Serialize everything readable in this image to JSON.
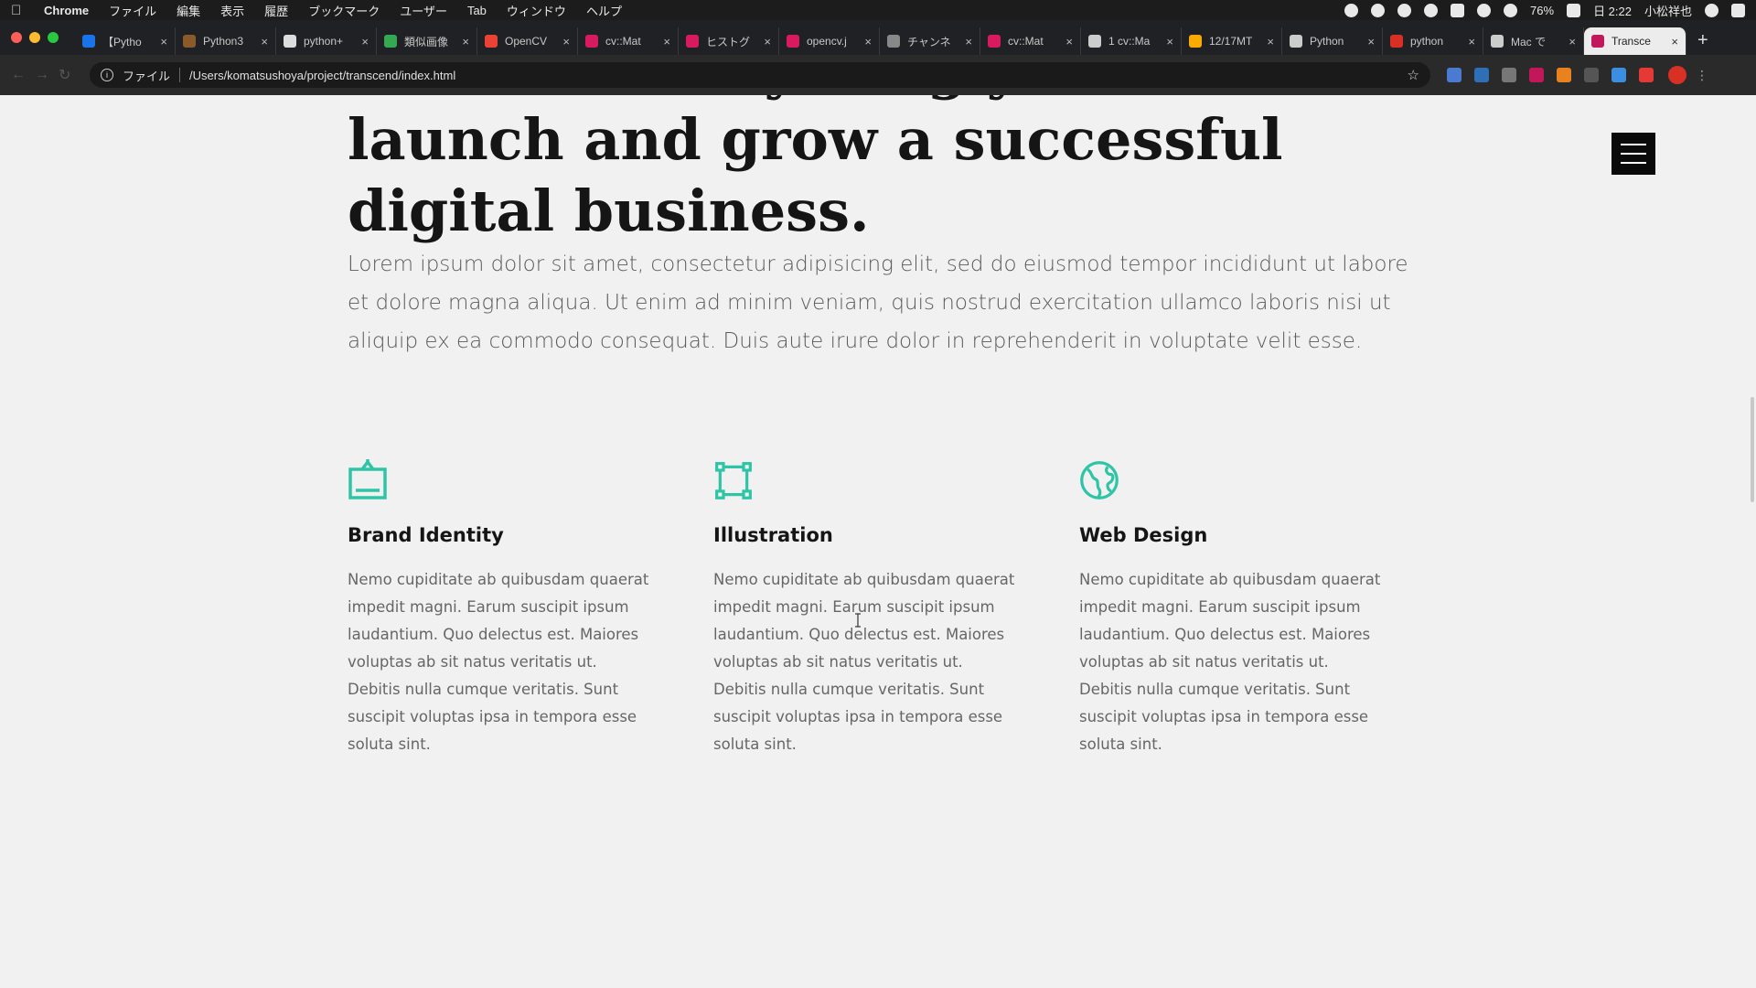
{
  "menubar": {
    "app": "Chrome",
    "items": [
      "ファイル",
      "編集",
      "表示",
      "履歴",
      "ブックマーク",
      "ユーザー",
      "Tab",
      "ウィンドウ",
      "ヘルプ"
    ],
    "battery": "76%",
    "clock": "日 2:22",
    "user": "小松祥也"
  },
  "tabs": [
    {
      "label": "【Pytho",
      "color": "#1a73e8"
    },
    {
      "label": "Python3",
      "color": "#8b5a2b"
    },
    {
      "label": "python+",
      "color": "#dddddd"
    },
    {
      "label": "類似画像",
      "color": "#34a853"
    },
    {
      "label": "OpenCV",
      "color": "#ea4335"
    },
    {
      "label": "cv::Mat",
      "color": "#d81b60"
    },
    {
      "label": "ヒストグ",
      "color": "#d81b60"
    },
    {
      "label": "opencv.j",
      "color": "#d81b60"
    },
    {
      "label": "チャンネ",
      "color": "#888888"
    },
    {
      "label": "cv::Mat",
      "color": "#d81b60"
    },
    {
      "label": "1 cv::Ma",
      "color": "#cccccc"
    },
    {
      "label": "12/17MT",
      "color": "#f9ab00"
    },
    {
      "label": "Python",
      "color": "#cccccc"
    },
    {
      "label": "python",
      "color": "#d93025"
    },
    {
      "label": "Mac で",
      "color": "#cccccc"
    },
    {
      "label": "Transce",
      "color": "#c2185b",
      "active": true
    }
  ],
  "toolbar": {
    "scheme": "ファイル",
    "url": "/Users/komatsushoya/project/transcend/index.html"
  },
  "page": {
    "headline": "We have everything you need to launch and grow a successful digital business.",
    "lead": "Lorem ipsum dolor sit amet, consectetur adipisicing elit, sed do eiusmod tempor incididunt ut labore et dolore magna aliqua. Ut enim ad minim veniam, quis nostrud exercitation ullamco laboris nisi ut aliquip ex ea commodo consequat. Duis aute irure dolor in reprehenderit in voluptate velit esse.",
    "accent_color": "#2ec4a6",
    "features": [
      {
        "icon": "tv-icon",
        "title": "Brand Identity",
        "text": "Nemo cupiditate ab quibusdam quaerat impedit magni. Earum suscipit ipsum laudantium. Quo delectus est. Maiores voluptas ab sit natus veritatis ut. Debitis nulla cumque veritatis. Sunt suscipit voluptas ipsa in tempora esse soluta sint."
      },
      {
        "icon": "vector-square-icon",
        "title": "Illustration",
        "text": "Nemo cupiditate ab quibusdam quaerat impedit magni. Earum suscipit ipsum laudantium. Quo delectus est. Maiores voluptas ab sit natus veritatis ut. Debitis nulla cumque veritatis. Sunt suscipit voluptas ipsa in tempora esse soluta sint."
      },
      {
        "icon": "globe-icon",
        "title": "Web Design",
        "text": "Nemo cupiditate ab quibusdam quaerat impedit magni. Earum suscipit ipsum laudantium. Quo delectus est. Maiores voluptas ab sit natus veritatis ut. Debitis nulla cumque veritatis. Sunt suscipit voluptas ipsa in tempora esse soluta sint."
      }
    ]
  }
}
